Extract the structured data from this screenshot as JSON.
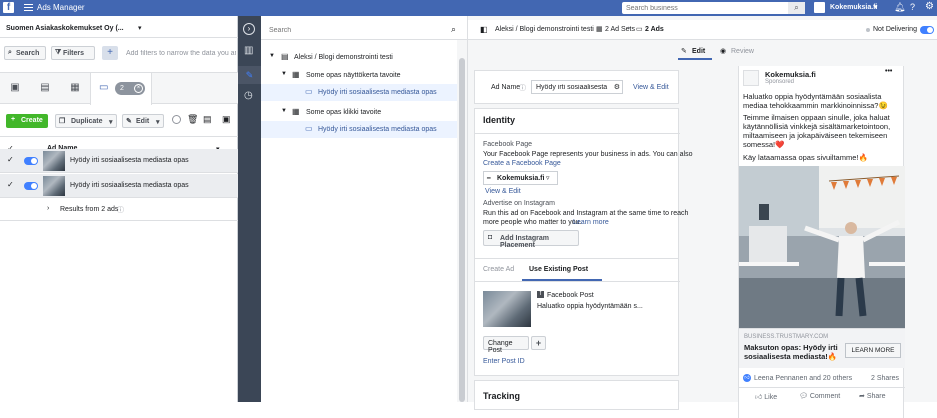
{
  "topbar": {
    "app_title": "Ads Manager",
    "search_placeholder": "Search business",
    "account_name": "Kokemuksia.fi"
  },
  "left": {
    "account_selector": "Suomen Asiakaskokemukset Oy (...",
    "search_btn": "Search",
    "filters_btn": "Filters",
    "filter_hint": "Add filters to narrow the data you are s",
    "selection_count": "2",
    "create_btn": "Create",
    "duplicate_btn": "Duplicate",
    "edit_btn": "Edit",
    "col_header": "Ad Name",
    "rows": [
      {
        "name": "Hyödy irti sosiaalisesta mediasta opas"
      },
      {
        "name": "Hyödy irti sosiaalisesta mediasta opas"
      }
    ],
    "results": "Results from 2 ads"
  },
  "tree": {
    "search_placeholder": "Search",
    "campaign": "Aleksi / Blogi demonstrointi testi",
    "adsets": [
      {
        "name": "Some opas näyttökerta tavoite",
        "ad": "Hyödy irti sosiaalisesta mediasta opas"
      },
      {
        "name": "Some opas klikki tavoite",
        "ad": "Hyödy irti sosiaalisesta mediasta opas"
      }
    ]
  },
  "editor": {
    "breadcrumb": [
      "Aleksi / Blogi demonstrointi testi",
      "2 Ad Sets",
      "2 Ads"
    ],
    "status": "Not Delivering",
    "tab_edit": "Edit",
    "tab_review": "Review",
    "ad_name_label": "Ad Name",
    "ad_name_value": "Hyödy irti sosiaalisesta med",
    "view_edit": "View & Edit",
    "identity_title": "Identity",
    "fb_page_label": "Facebook Page",
    "fb_page_desc": "Your Facebook Page represents your business in ads. You can also",
    "create_page_link": "Create a Facebook Page",
    "page_value": "Kokemuksia.fi",
    "view_edit2": "View & Edit",
    "instagram_label": "Advertise on Instagram",
    "instagram_desc1": "Run this ad on Facebook and Instagram at the same time to reach",
    "instagram_desc2": "more people who matter to you.",
    "learn_more": "Learn more",
    "add_instagram": "Add Instagram Placement",
    "tab_create_ad": "Create Ad",
    "tab_existing": "Use Existing Post",
    "post_type": "Facebook Post",
    "post_text": "Haluatko oppia hyödyntämään s...",
    "change_post": "Change Post",
    "enter_post_id": "Enter Post ID",
    "tracking_title": "Tracking"
  },
  "preview": {
    "page": "Kokemuksia.fi",
    "sponsored": "Sponsored",
    "text1": "Haluatko oppia hyödyntämään sosiaalista mediaa tehokkaammin markkinoinnissa?😉",
    "text2": "Teimme ilmaisen oppaan sinulle, joka haluat käytännöllisiä vinkkejä sisältämarketointoon, miltaamiseen ja jokapäiväiseen tekemiseen somessa!❤️",
    "text3": "Käy lataamassa opas sivuiltamme!🔥",
    "domain": "BUSINESS.TRUSTMARY.COM",
    "headline": "Maksuton opas: Hyödy irti sosiaalisesta mediasta!🔥",
    "cta": "LEARN MORE",
    "reactions": "Leena Pennanen and 20 others",
    "shares": "2 Shares",
    "like": "Like",
    "comment": "Comment",
    "share": "Share"
  }
}
